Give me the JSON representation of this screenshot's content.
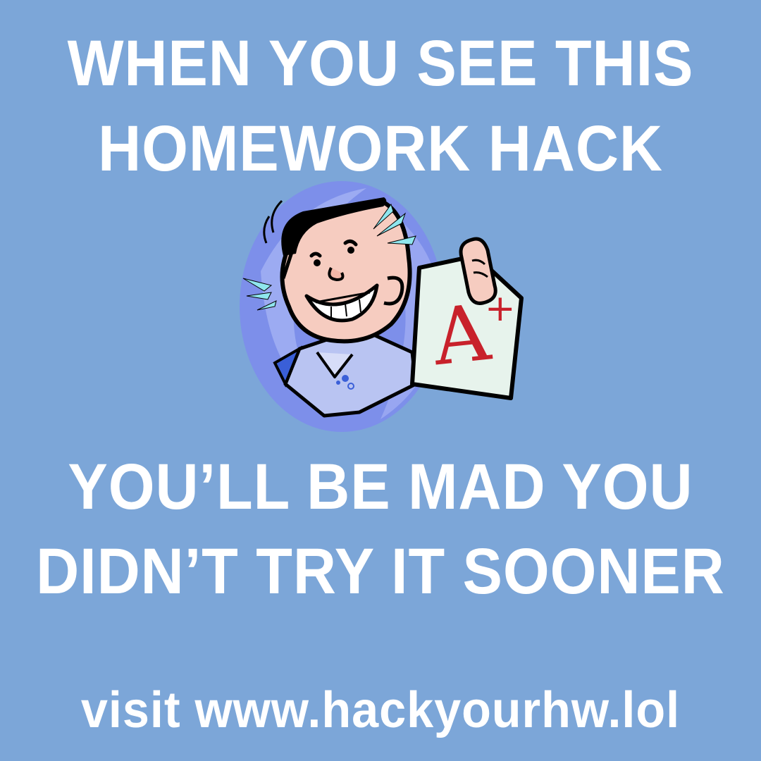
{
  "headline_top": {
    "line1": "WHEN YOU SEE THIS",
    "line2": "HOMEWORK HACK"
  },
  "headline_bottom": {
    "line1": "YOU’LL BE MAD YOU",
    "line2": "DIDN’T TRY IT SOONER"
  },
  "footer": {
    "text": "visit www.hackyourhw.lol"
  },
  "illustration": {
    "icon": "student-with-grade-paper-icon",
    "grade": "A",
    "grade_modifier": "+"
  },
  "colors": {
    "background": "#7ca6d8",
    "text": "#ffffff",
    "oval": "#7a8fe9",
    "grade_red": "#c8212b"
  }
}
